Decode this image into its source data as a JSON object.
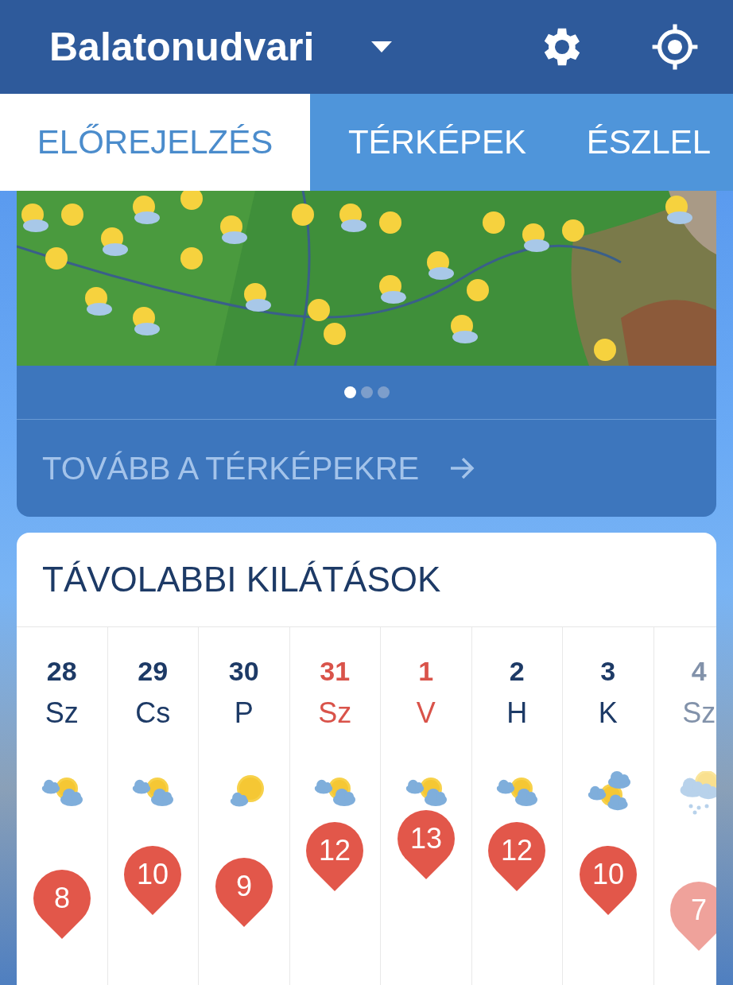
{
  "header": {
    "location": "Balatonudvari"
  },
  "tabs": [
    {
      "label": "ELŐREJELZÉS",
      "selected": true
    },
    {
      "label": "TÉRKÉPEK",
      "selected": false
    },
    {
      "label": "ÉSZLEL",
      "selected": false
    }
  ],
  "map_card": {
    "pager": [
      {
        "selected": true
      },
      {
        "selected": false
      },
      {
        "selected": false
      }
    ],
    "link": "TOVÁBB A TÉRKÉPEKRE"
  },
  "outlook": {
    "title": "TÁVOLABBI KILÁTÁSOK",
    "days": [
      {
        "date": "28",
        "day": "Sz",
        "weekend": false,
        "kind": "partly_cloudy",
        "temp": "8"
      },
      {
        "date": "29",
        "day": "Cs",
        "weekend": false,
        "kind": "partly_cloudy",
        "temp": "10"
      },
      {
        "date": "30",
        "day": "P",
        "weekend": false,
        "kind": "mostly_sunny",
        "temp": "9"
      },
      {
        "date": "31",
        "day": "Sz",
        "weekend": true,
        "kind": "partly_cloudy",
        "temp": "12"
      },
      {
        "date": "1",
        "day": "V",
        "weekend": true,
        "kind": "partly_cloudy",
        "temp": "13"
      },
      {
        "date": "2",
        "day": "H",
        "weekend": false,
        "kind": "partly_cloudy",
        "temp": "12"
      },
      {
        "date": "3",
        "day": "K",
        "weekend": false,
        "kind": "cloudy",
        "temp": "10"
      },
      {
        "date": "4",
        "day": "Sz",
        "weekend": false,
        "kind": "rain",
        "temp": "7"
      }
    ]
  }
}
